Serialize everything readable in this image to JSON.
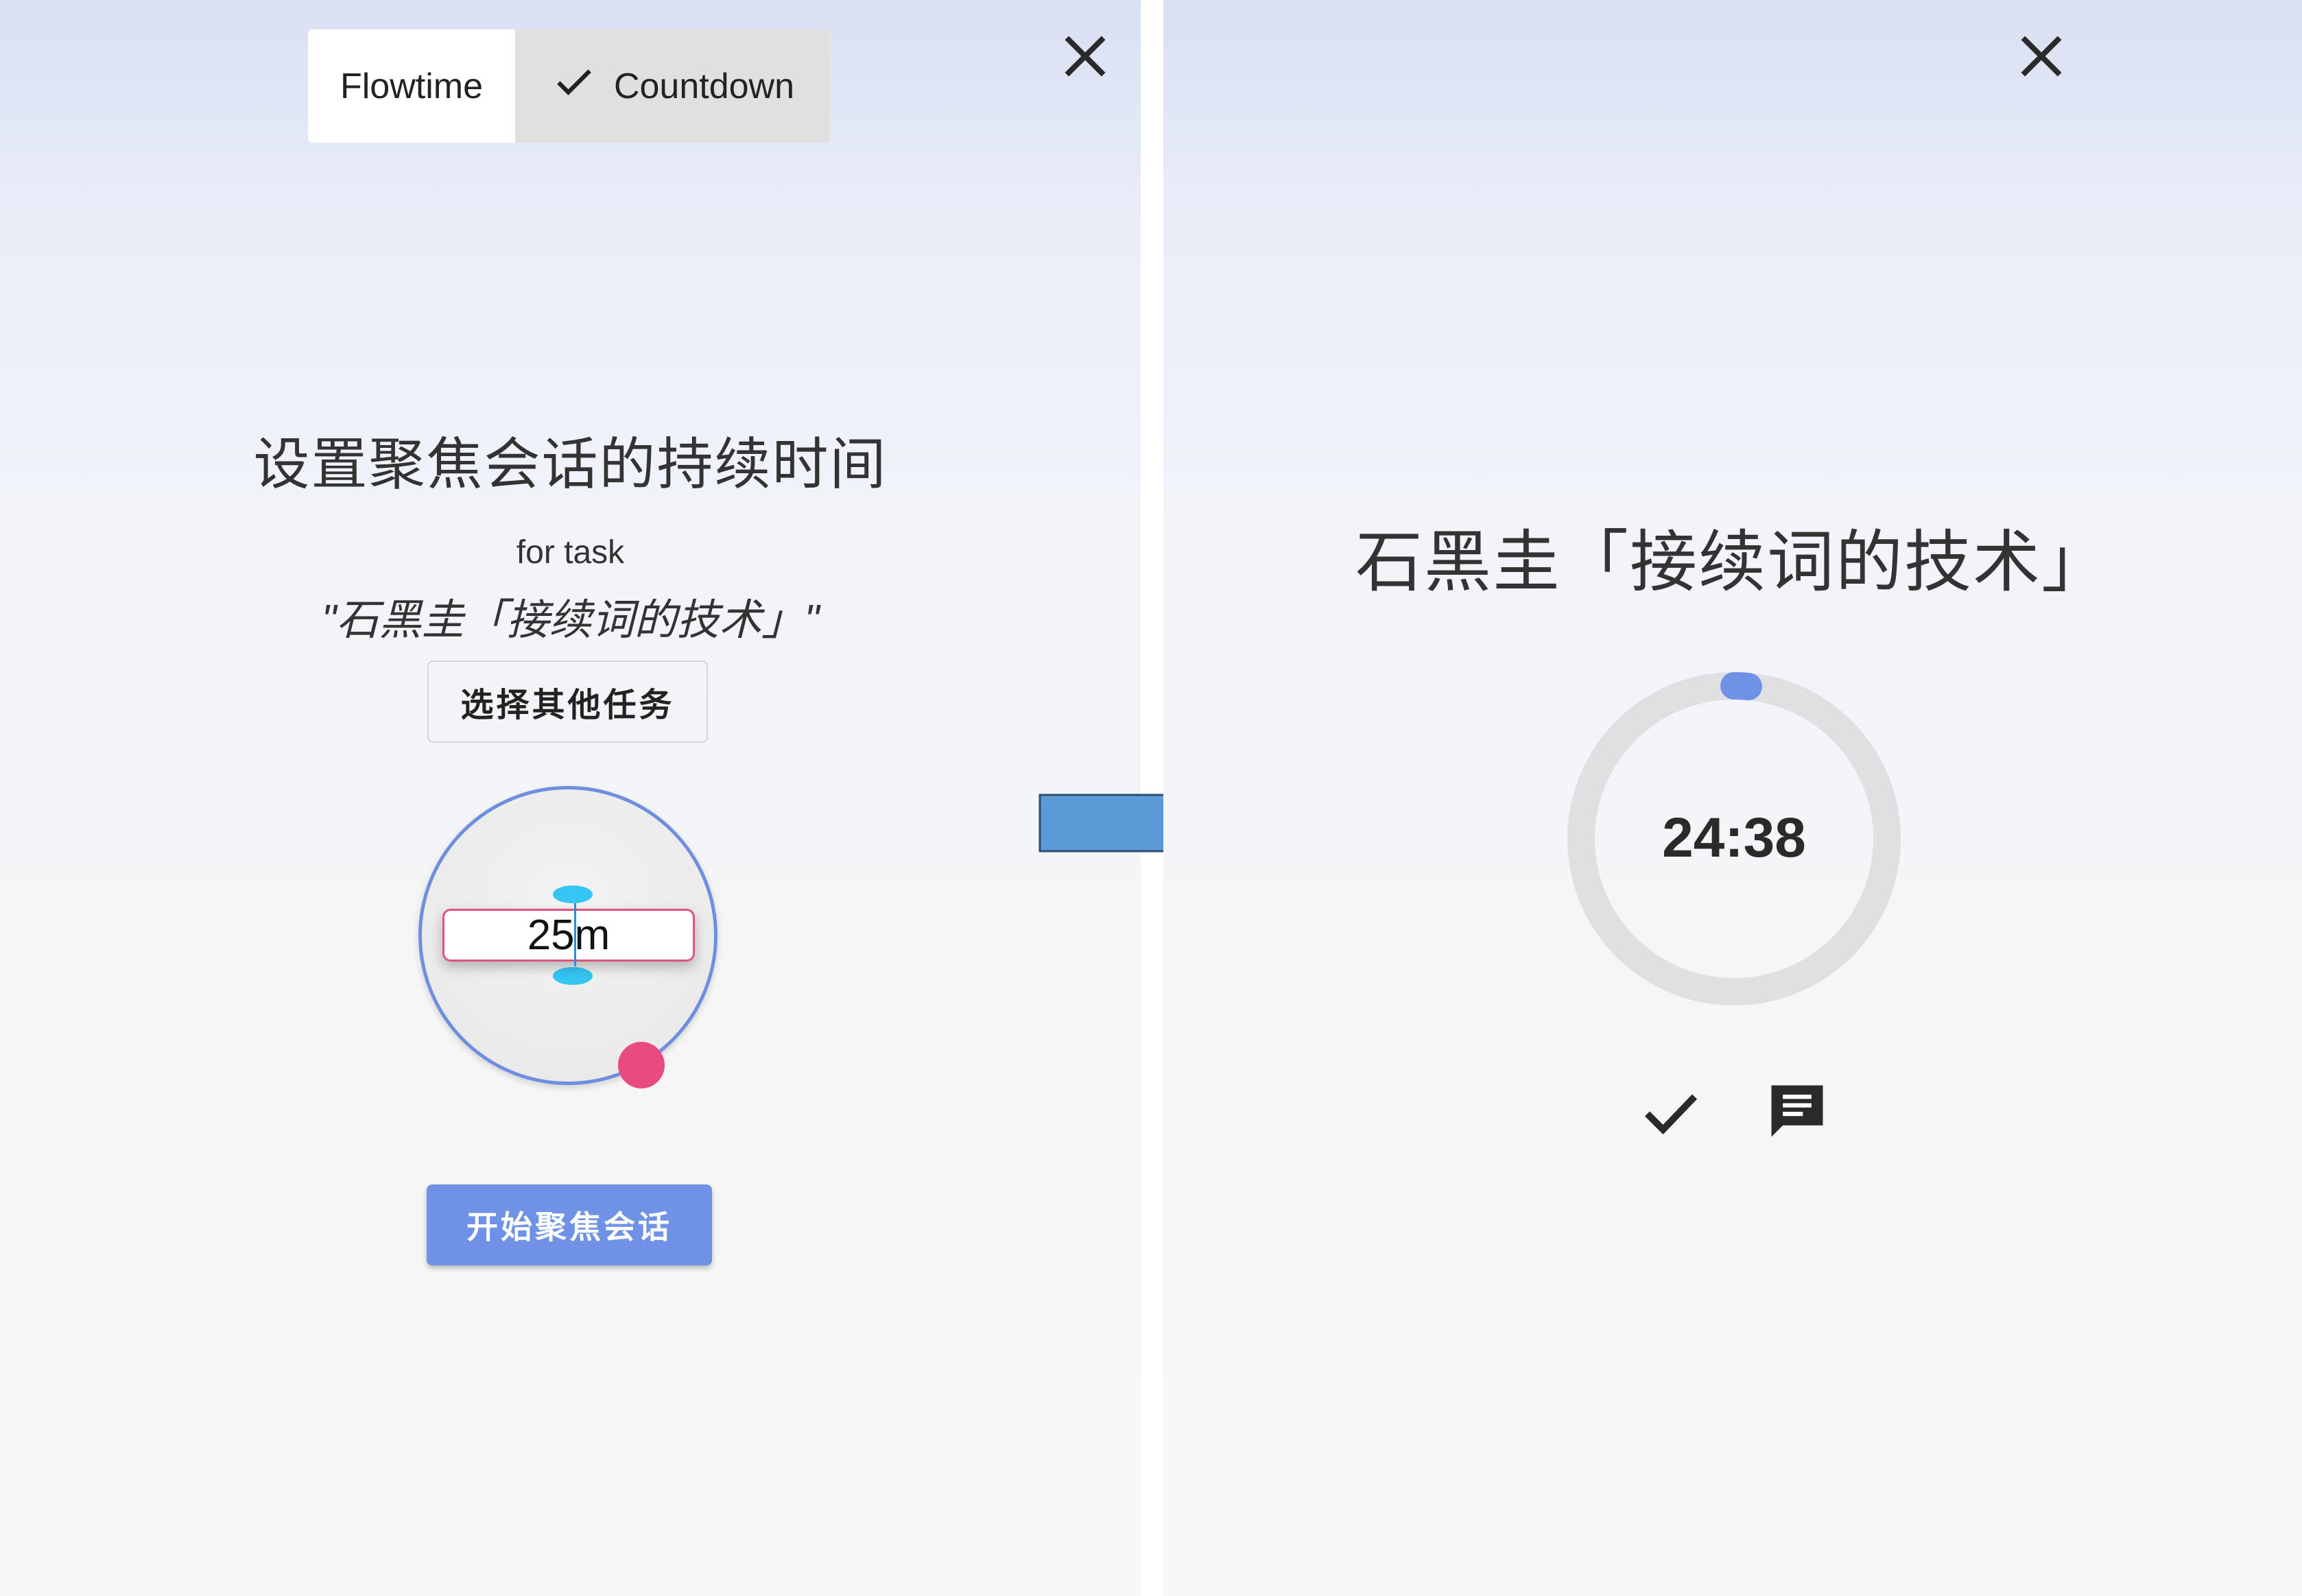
{
  "left": {
    "close_icon": "close-icon",
    "mode_toggle": {
      "options": [
        "Flowtime",
        "Countdown"
      ],
      "selected": "Countdown",
      "check_icon": "check-icon"
    },
    "heading": "设置聚焦会话的持续时间",
    "for_task_label": "for task",
    "task_name": "\"石黑圭「接续词的技术」\"",
    "choose_task_button": "选择其他任务",
    "duration_input_value": "25m",
    "start_button": "开始聚焦会话",
    "colors": {
      "accent": "#6f92e6",
      "dial_border": "#6e8fe0",
      "knob": "#e84b7f",
      "handle": "#35c6f4"
    }
  },
  "right": {
    "close_icon": "close-icon",
    "task_title": "石黑圭「接续词的技术」",
    "timer_text": "24:38",
    "timer_progress": 0.015,
    "complete_icon": "check-icon",
    "note_icon": "comment-icon",
    "colors": {
      "ring_track": "#e0e0e2",
      "ring_progress": "#6f92e6"
    }
  },
  "transition_arrow_icon": "right-arrow-icon"
}
